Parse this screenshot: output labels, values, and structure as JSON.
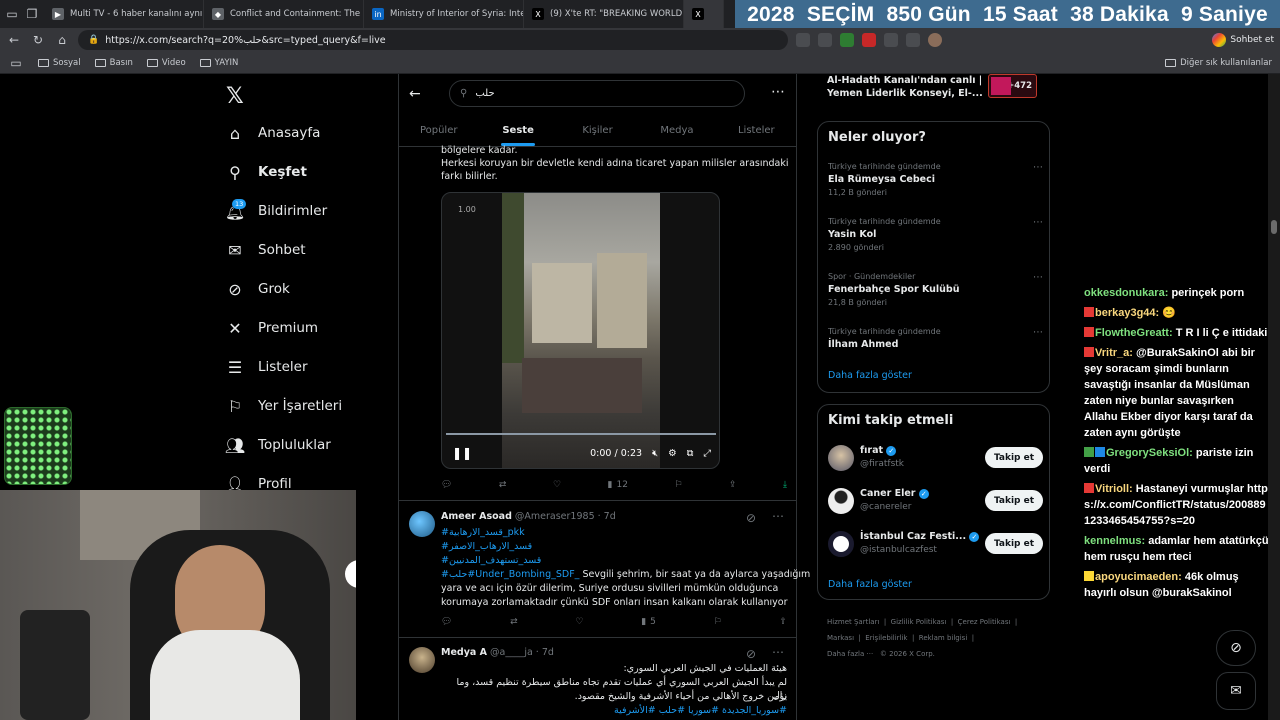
{
  "browser": {
    "tabs": [
      {
        "title": "Multi TV - 6 haber kanalını aynı an"
      },
      {
        "title": "Conflict and Containment: The Sie"
      },
      {
        "title": "Ministry of Interior of Syria: Interna"
      },
      {
        "title": "(9) X'te RT: \"BREAKING WORLD EX"
      },
      {
        "title": "X"
      }
    ],
    "url": "https://x.com/search?q=20%حلب&src=typed_query&f=live",
    "chat_button": "Sohbet et",
    "bookmarks": [
      "Sosyal",
      "Basın",
      "Video",
      "YAYIN"
    ],
    "other_bookmarks": "Diğer sık kullanılanlar"
  },
  "countdown": {
    "year": "2028",
    "label": "SEÇİM",
    "days": "850 Gün",
    "hours": "15 Saat",
    "minutes": "38 Dakika",
    "seconds": "9 Saniye"
  },
  "nav": {
    "items": [
      {
        "label": "Anasayfa"
      },
      {
        "label": "Keşfet"
      },
      {
        "label": "Bildirimler"
      },
      {
        "label": "Sohbet"
      },
      {
        "label": "Grok"
      },
      {
        "label": "Premium"
      },
      {
        "label": "Listeler"
      },
      {
        "label": "Yer İşaretleri"
      },
      {
        "label": "Topluluklar"
      },
      {
        "label": "Profil"
      }
    ],
    "notif_count": "13"
  },
  "search": {
    "query": "حلب",
    "tabs": [
      "Popüler",
      "Seste",
      "Kişiler",
      "Medya",
      "Listeler"
    ]
  },
  "posts": {
    "p1": {
      "line1": "bölgelere kadar.",
      "line2": "Herkesi koruyan bir devletle kendi adına ticaret yapan milisler arasındaki",
      "line3": "farkı bilirler.",
      "video_speed": "1.00",
      "video_time": "0:00 / 0:23",
      "views": "12"
    },
    "p2": {
      "name": "Ameer Asoad",
      "handle": "@Ameraser1985 · 7d",
      "tags": [
        "#قسد_الارهابية_pkk",
        "#قسد_الارهاب_الاصفر",
        "#قسد_تستهدف_المدنيين"
      ],
      "tag4": "#حلب",
      "tag5": "#Under_Bombing_SDF_",
      "text1": "Sevgili şehrim, bir saat ya da aylarca yaşadığım",
      "text2": "yara ve acı için özür dilerim, Suriye ordusu sivilleri mümkün olduğunca",
      "text3": "korumaya zorlamaktadır çünkü SDF onları insan kalkanı olarak kullanıyor",
      "views": "5"
    },
    "p3": {
      "name": "Medya A",
      "handle": "@a____ja · 7d",
      "line1": "هيئة العمليات في الجيش العربي السوري:",
      "line2": "لم يبدأ الجيش العربي السوري أي عمليات تقدم تجاه مناطق سيطرة تنظيم قسد، وما زال",
      "line3": "يؤمن خروج الأهالي من أحياء الأشرفية والشيخ مقصود.",
      "line4": "#سوريا_الجديدة #سوريا #حلب #الأشرفية"
    }
  },
  "right": {
    "top_item": {
      "line1": "Al-Hadath Kanalı'ndan canlı |",
      "line2": "Yemen Liderlik Konseyi, El-...",
      "count": "+472"
    },
    "trending_title": "Neler oluyor?",
    "trends": [
      {
        "meta": "Türkiye tarihinde gündemde",
        "name": "Ela Rümeysa Cebeci",
        "count": "11,2 B gönderi"
      },
      {
        "meta": "Türkiye tarihinde gündemde",
        "name": "Yasin Kol",
        "count": "2.890 gönderi"
      },
      {
        "meta": "Spor · Gündemdekiler",
        "name": "Fenerbahçe Spor Kulübü",
        "count": "21,8 B gönderi"
      },
      {
        "meta": "Türkiye tarihinde gündemde",
        "name": "İlham Ahmed",
        "count": ""
      }
    ],
    "show_more": "Daha fazla göster",
    "follow_title": "Kimi takip etmeli",
    "follows": [
      {
        "name": "fırat",
        "handle": "@firatfstk",
        "button": "Takip et"
      },
      {
        "name": "Caner Eler",
        "handle": "@canereler",
        "button": "Takip et"
      },
      {
        "name": "İstanbul Caz Festi...",
        "handle": "@istanbulcazfest",
        "button": "Takip et"
      }
    ],
    "footer": [
      "Hizmet Şartları",
      "Gizlilik Politikası",
      "Çerez Politikası",
      "Markası",
      "Erişilebilirlik",
      "Reklam bilgisi",
      "Daha fazla ···",
      "© 2026 X Corp."
    ]
  },
  "chat": [
    {
      "user": "okkesdonukara:",
      "msg": "perinçek porn"
    },
    {
      "user": "berkay3g44:",
      "msg": "😊"
    },
    {
      "user": "FlowtheGreatt:",
      "msg": "T R I li Ç e ittidaki"
    },
    {
      "user": "Vritr_a:",
      "msg": "@BurakSakinOl abi bir şey soracam şimdi bunların savaştığı insanlar da Müslüman zaten niye bunlar savaşırken Allahu Ekber diyor karşı taraf da zaten aynı görüşte"
    },
    {
      "user": "GregorySeksiOl:",
      "msg": "pariste izin verdi"
    },
    {
      "user": "Vitrioll:",
      "msg": "Hastaneyi vurmuşlar https://x.com/ConflictTR/status/2008891233465454755?s=20"
    },
    {
      "user": "kennelmus:",
      "msg": "adamlar hem atatürkçü hem rusçu hem rteci"
    },
    {
      "user": "apoyucimaeden:",
      "msg": "46k olmuş hayırlı olsun @burakSakinol"
    }
  ],
  "colors": {
    "accent": "#1d9bf0",
    "countdown_bg": "#3e6b8f",
    "chat_user": "#7fe07f"
  }
}
